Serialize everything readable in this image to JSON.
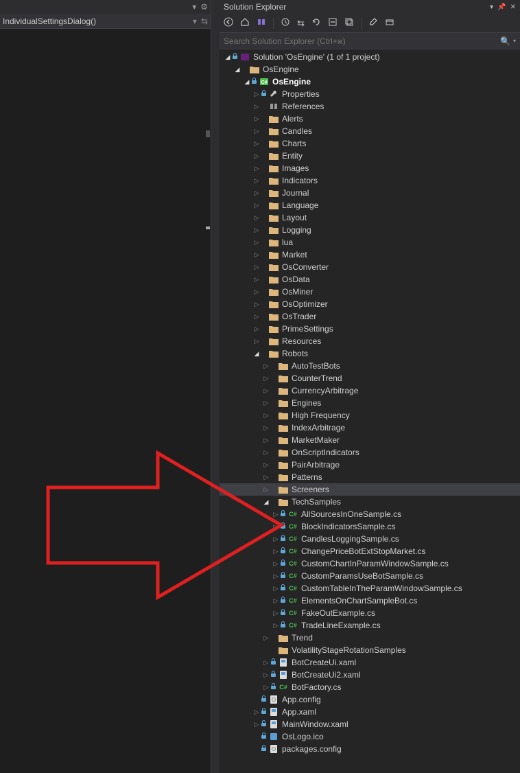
{
  "panel_title": "Solution Explorer",
  "search_placeholder": "Search Solution Explorer (Ctrl+ж)",
  "left_crumb": "IndividualSettingsDialog()",
  "arrow_color": "#e02020",
  "tree": [
    {
      "d": 0,
      "exp": "open",
      "lock": true,
      "icon": "sln",
      "label": "Solution 'OsEngine' (1 of 1 project)"
    },
    {
      "d": 1,
      "exp": "open",
      "lock": false,
      "icon": "folder",
      "label": "OsEngine"
    },
    {
      "d": 2,
      "exp": "open",
      "lock": true,
      "icon": "csproj",
      "label": "OsEngine",
      "bold": true
    },
    {
      "d": 3,
      "exp": "closed",
      "lock": true,
      "icon": "wrench",
      "label": "Properties"
    },
    {
      "d": 3,
      "exp": "closed",
      "lock": false,
      "icon": "refs",
      "label": "References"
    },
    {
      "d": 3,
      "exp": "closed",
      "lock": false,
      "icon": "folder",
      "label": "Alerts"
    },
    {
      "d": 3,
      "exp": "closed",
      "lock": false,
      "icon": "folder",
      "label": "Candles"
    },
    {
      "d": 3,
      "exp": "closed",
      "lock": false,
      "icon": "folder",
      "label": "Charts"
    },
    {
      "d": 3,
      "exp": "closed",
      "lock": false,
      "icon": "folder",
      "label": "Entity"
    },
    {
      "d": 3,
      "exp": "closed",
      "lock": false,
      "icon": "folder",
      "label": "Images"
    },
    {
      "d": 3,
      "exp": "closed",
      "lock": false,
      "icon": "folder",
      "label": "Indicators"
    },
    {
      "d": 3,
      "exp": "closed",
      "lock": false,
      "icon": "folder",
      "label": "Journal"
    },
    {
      "d": 3,
      "exp": "closed",
      "lock": false,
      "icon": "folder",
      "label": "Language"
    },
    {
      "d": 3,
      "exp": "closed",
      "lock": false,
      "icon": "folder",
      "label": "Layout"
    },
    {
      "d": 3,
      "exp": "closed",
      "lock": false,
      "icon": "folder",
      "label": "Logging"
    },
    {
      "d": 3,
      "exp": "closed",
      "lock": false,
      "icon": "folder",
      "label": "lua"
    },
    {
      "d": 3,
      "exp": "closed",
      "lock": false,
      "icon": "folder",
      "label": "Market"
    },
    {
      "d": 3,
      "exp": "closed",
      "lock": false,
      "icon": "folder",
      "label": "OsConverter"
    },
    {
      "d": 3,
      "exp": "closed",
      "lock": false,
      "icon": "folder",
      "label": "OsData"
    },
    {
      "d": 3,
      "exp": "closed",
      "lock": false,
      "icon": "folder",
      "label": "OsMiner"
    },
    {
      "d": 3,
      "exp": "closed",
      "lock": false,
      "icon": "folder",
      "label": "OsOptimizer"
    },
    {
      "d": 3,
      "exp": "closed",
      "lock": false,
      "icon": "folder",
      "label": "OsTrader"
    },
    {
      "d": 3,
      "exp": "closed",
      "lock": false,
      "icon": "folder",
      "label": "PrimeSettings"
    },
    {
      "d": 3,
      "exp": "closed",
      "lock": false,
      "icon": "folder",
      "label": "Resources"
    },
    {
      "d": 3,
      "exp": "open",
      "lock": false,
      "icon": "folder",
      "label": "Robots"
    },
    {
      "d": 4,
      "exp": "closed",
      "lock": false,
      "icon": "folder",
      "label": "AutoTestBots"
    },
    {
      "d": 4,
      "exp": "closed",
      "lock": false,
      "icon": "folder",
      "label": "CounterTrend"
    },
    {
      "d": 4,
      "exp": "closed",
      "lock": false,
      "icon": "folder",
      "label": "CurrencyArbitrage"
    },
    {
      "d": 4,
      "exp": "closed",
      "lock": false,
      "icon": "folder",
      "label": "Engines"
    },
    {
      "d": 4,
      "exp": "closed",
      "lock": false,
      "icon": "folder",
      "label": "High Frequency"
    },
    {
      "d": 4,
      "exp": "closed",
      "lock": false,
      "icon": "folder",
      "label": "IndexArbitrage"
    },
    {
      "d": 4,
      "exp": "closed",
      "lock": false,
      "icon": "folder",
      "label": "MarketMaker"
    },
    {
      "d": 4,
      "exp": "closed",
      "lock": false,
      "icon": "folder",
      "label": "OnScriptIndicators"
    },
    {
      "d": 4,
      "exp": "closed",
      "lock": false,
      "icon": "folder",
      "label": "PairArbitrage"
    },
    {
      "d": 4,
      "exp": "closed",
      "lock": false,
      "icon": "folder",
      "label": "Patterns"
    },
    {
      "d": 4,
      "exp": "closed",
      "lock": false,
      "icon": "folder",
      "label": "Screeners",
      "selected": true
    },
    {
      "d": 4,
      "exp": "open",
      "lock": false,
      "icon": "folder",
      "label": "TechSamples"
    },
    {
      "d": 5,
      "exp": "closed",
      "lock": true,
      "icon": "cs",
      "label": "AllSourcesInOneSample.cs"
    },
    {
      "d": 5,
      "exp": "closed",
      "lock": true,
      "icon": "cs",
      "label": "BlockIndicatorsSample.cs"
    },
    {
      "d": 5,
      "exp": "closed",
      "lock": true,
      "icon": "cs",
      "label": "CandlesLoggingSample.cs"
    },
    {
      "d": 5,
      "exp": "closed",
      "lock": true,
      "icon": "cs",
      "label": "ChangePriceBotExtStopMarket.cs"
    },
    {
      "d": 5,
      "exp": "closed",
      "lock": true,
      "icon": "cs",
      "label": "CustomChartInParamWindowSample.cs"
    },
    {
      "d": 5,
      "exp": "closed",
      "lock": true,
      "icon": "cs",
      "label": "CustomParamsUseBotSample.cs"
    },
    {
      "d": 5,
      "exp": "closed",
      "lock": true,
      "icon": "cs",
      "label": "CustomTableInTheParamWindowSample.cs"
    },
    {
      "d": 5,
      "exp": "closed",
      "lock": true,
      "icon": "cs",
      "label": "ElementsOnChartSampleBot.cs"
    },
    {
      "d": 5,
      "exp": "closed",
      "lock": true,
      "icon": "cs",
      "label": "FakeOutExample.cs"
    },
    {
      "d": 5,
      "exp": "closed",
      "lock": true,
      "icon": "cs",
      "label": "TradeLineExample.cs"
    },
    {
      "d": 4,
      "exp": "closed",
      "lock": false,
      "icon": "folder",
      "label": "Trend"
    },
    {
      "d": 4,
      "exp": "none",
      "lock": false,
      "icon": "folder",
      "label": "VolatilityStageRotationSamples"
    },
    {
      "d": 4,
      "exp": "closed",
      "lock": true,
      "icon": "xaml",
      "label": "BotCreateUi.xaml"
    },
    {
      "d": 4,
      "exp": "closed",
      "lock": true,
      "icon": "xaml",
      "label": "BotCreateUi2.xaml"
    },
    {
      "d": 4,
      "exp": "closed",
      "lock": true,
      "icon": "cs",
      "label": "BotFactory.cs"
    },
    {
      "d": 3,
      "exp": "none",
      "lock": true,
      "icon": "config",
      "label": "App.config"
    },
    {
      "d": 3,
      "exp": "closed",
      "lock": true,
      "icon": "xaml",
      "label": "App.xaml"
    },
    {
      "d": 3,
      "exp": "closed",
      "lock": true,
      "icon": "xaml",
      "label": "MainWindow.xaml"
    },
    {
      "d": 3,
      "exp": "none",
      "lock": true,
      "icon": "ico",
      "label": "OsLogo.ico"
    },
    {
      "d": 3,
      "exp": "none",
      "lock": true,
      "icon": "config",
      "label": "packages.config"
    }
  ]
}
